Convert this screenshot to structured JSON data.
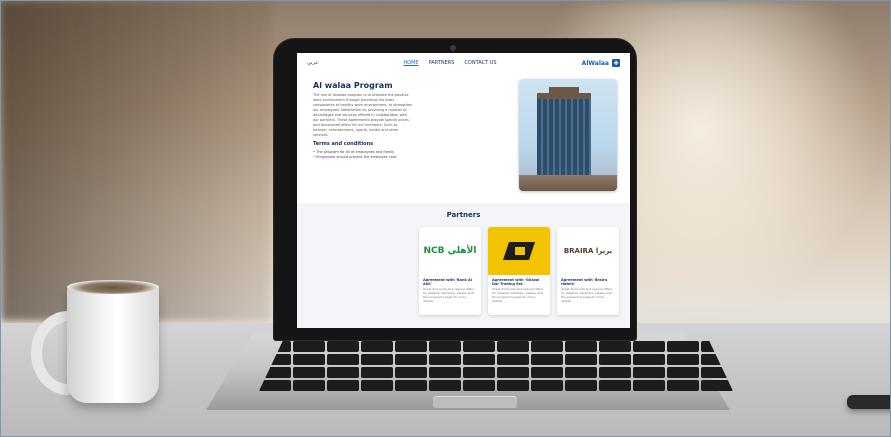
{
  "website": {
    "header": {
      "lang_toggle": "عربي",
      "nav": [
        "HOME",
        "PARTNERS",
        "CONTACT US"
      ],
      "logo_text": "AlWalaa"
    },
    "hero": {
      "title": "Al walaa Program",
      "description": "The aim of Alwalaa program is to promote the positive work environment through providing the basic components of healthy work environment, to strengthen our employees' satisfaction by providing a number of advantages and services offered in collaboration with our partners. These agreements provide special prices and discounted offers for our members. Such as tourism, entertainment, sports, health and other services."
    },
    "terms": {
      "title": "Terms and conditions",
      "items": [
        "The program for all of employees and family",
        "Employees should present the employee card"
      ]
    },
    "partners": {
      "title": "Partners",
      "cards": [
        {
          "logo": "NCB الأهلي",
          "title": "Agreement with 'Bank Al Ahli'",
          "text": "Great discounts and special offers for Alwalaa members, please visit the program's page for more details."
        },
        {
          "logo": "",
          "title": "Agreement with 'Ghazal Dar Trading Est.'",
          "text": "Great discounts and special offers for Alwalaa members, please visit the program's page for more details."
        },
        {
          "logo": "BRAIRA بريرا",
          "title": "Agreement with 'Braira Hotels'",
          "text": "Great discounts and special offers for Alwalaa members, please visit the program's page for more details."
        }
      ]
    }
  },
  "colors": {
    "accent": "#1a5db0",
    "navy": "#16325c",
    "yellow_logo": "#f2c400"
  }
}
